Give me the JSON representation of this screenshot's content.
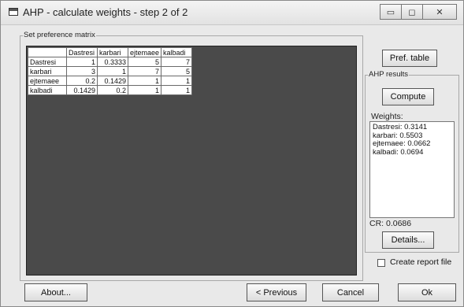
{
  "window": {
    "title": "AHP - calculate weights - step 2 of 2",
    "controls": {
      "minimize": "▭",
      "maximize": "◻",
      "close": "✕"
    }
  },
  "matrix_group": {
    "label": "Set preference matrix",
    "columns": [
      "Dastresi",
      "karbari",
      "ejtemaee",
      "kalbadi"
    ],
    "rows": [
      {
        "label": "Dastresi",
        "values": [
          "1",
          "0.3333",
          "5",
          "7"
        ]
      },
      {
        "label": "karbari",
        "values": [
          "3",
          "1",
          "7",
          "5"
        ]
      },
      {
        "label": "ejtemaee",
        "values": [
          "0.2",
          "0.1429",
          "1",
          "1"
        ]
      },
      {
        "label": "kalbadi",
        "values": [
          "0.1429",
          "0.2",
          "1",
          "1"
        ]
      }
    ]
  },
  "side": {
    "pref_table_button": "Pref. table",
    "results_label": "AHP results",
    "compute_button": "Compute",
    "weights_label": "Weights:",
    "weights": [
      "Dastresi: 0.3141",
      "karbari: 0.5503",
      "ejtemaee: 0.0662",
      "kalbadi: 0.0694"
    ],
    "cr_text": "CR: 0.0686",
    "details_button": "Details...",
    "create_report_label": "Create report file",
    "create_report_checked": false
  },
  "footer": {
    "about_button": "About...",
    "previous_button": "< Previous",
    "cancel_button": "Cancel",
    "ok_button": "Ok"
  }
}
